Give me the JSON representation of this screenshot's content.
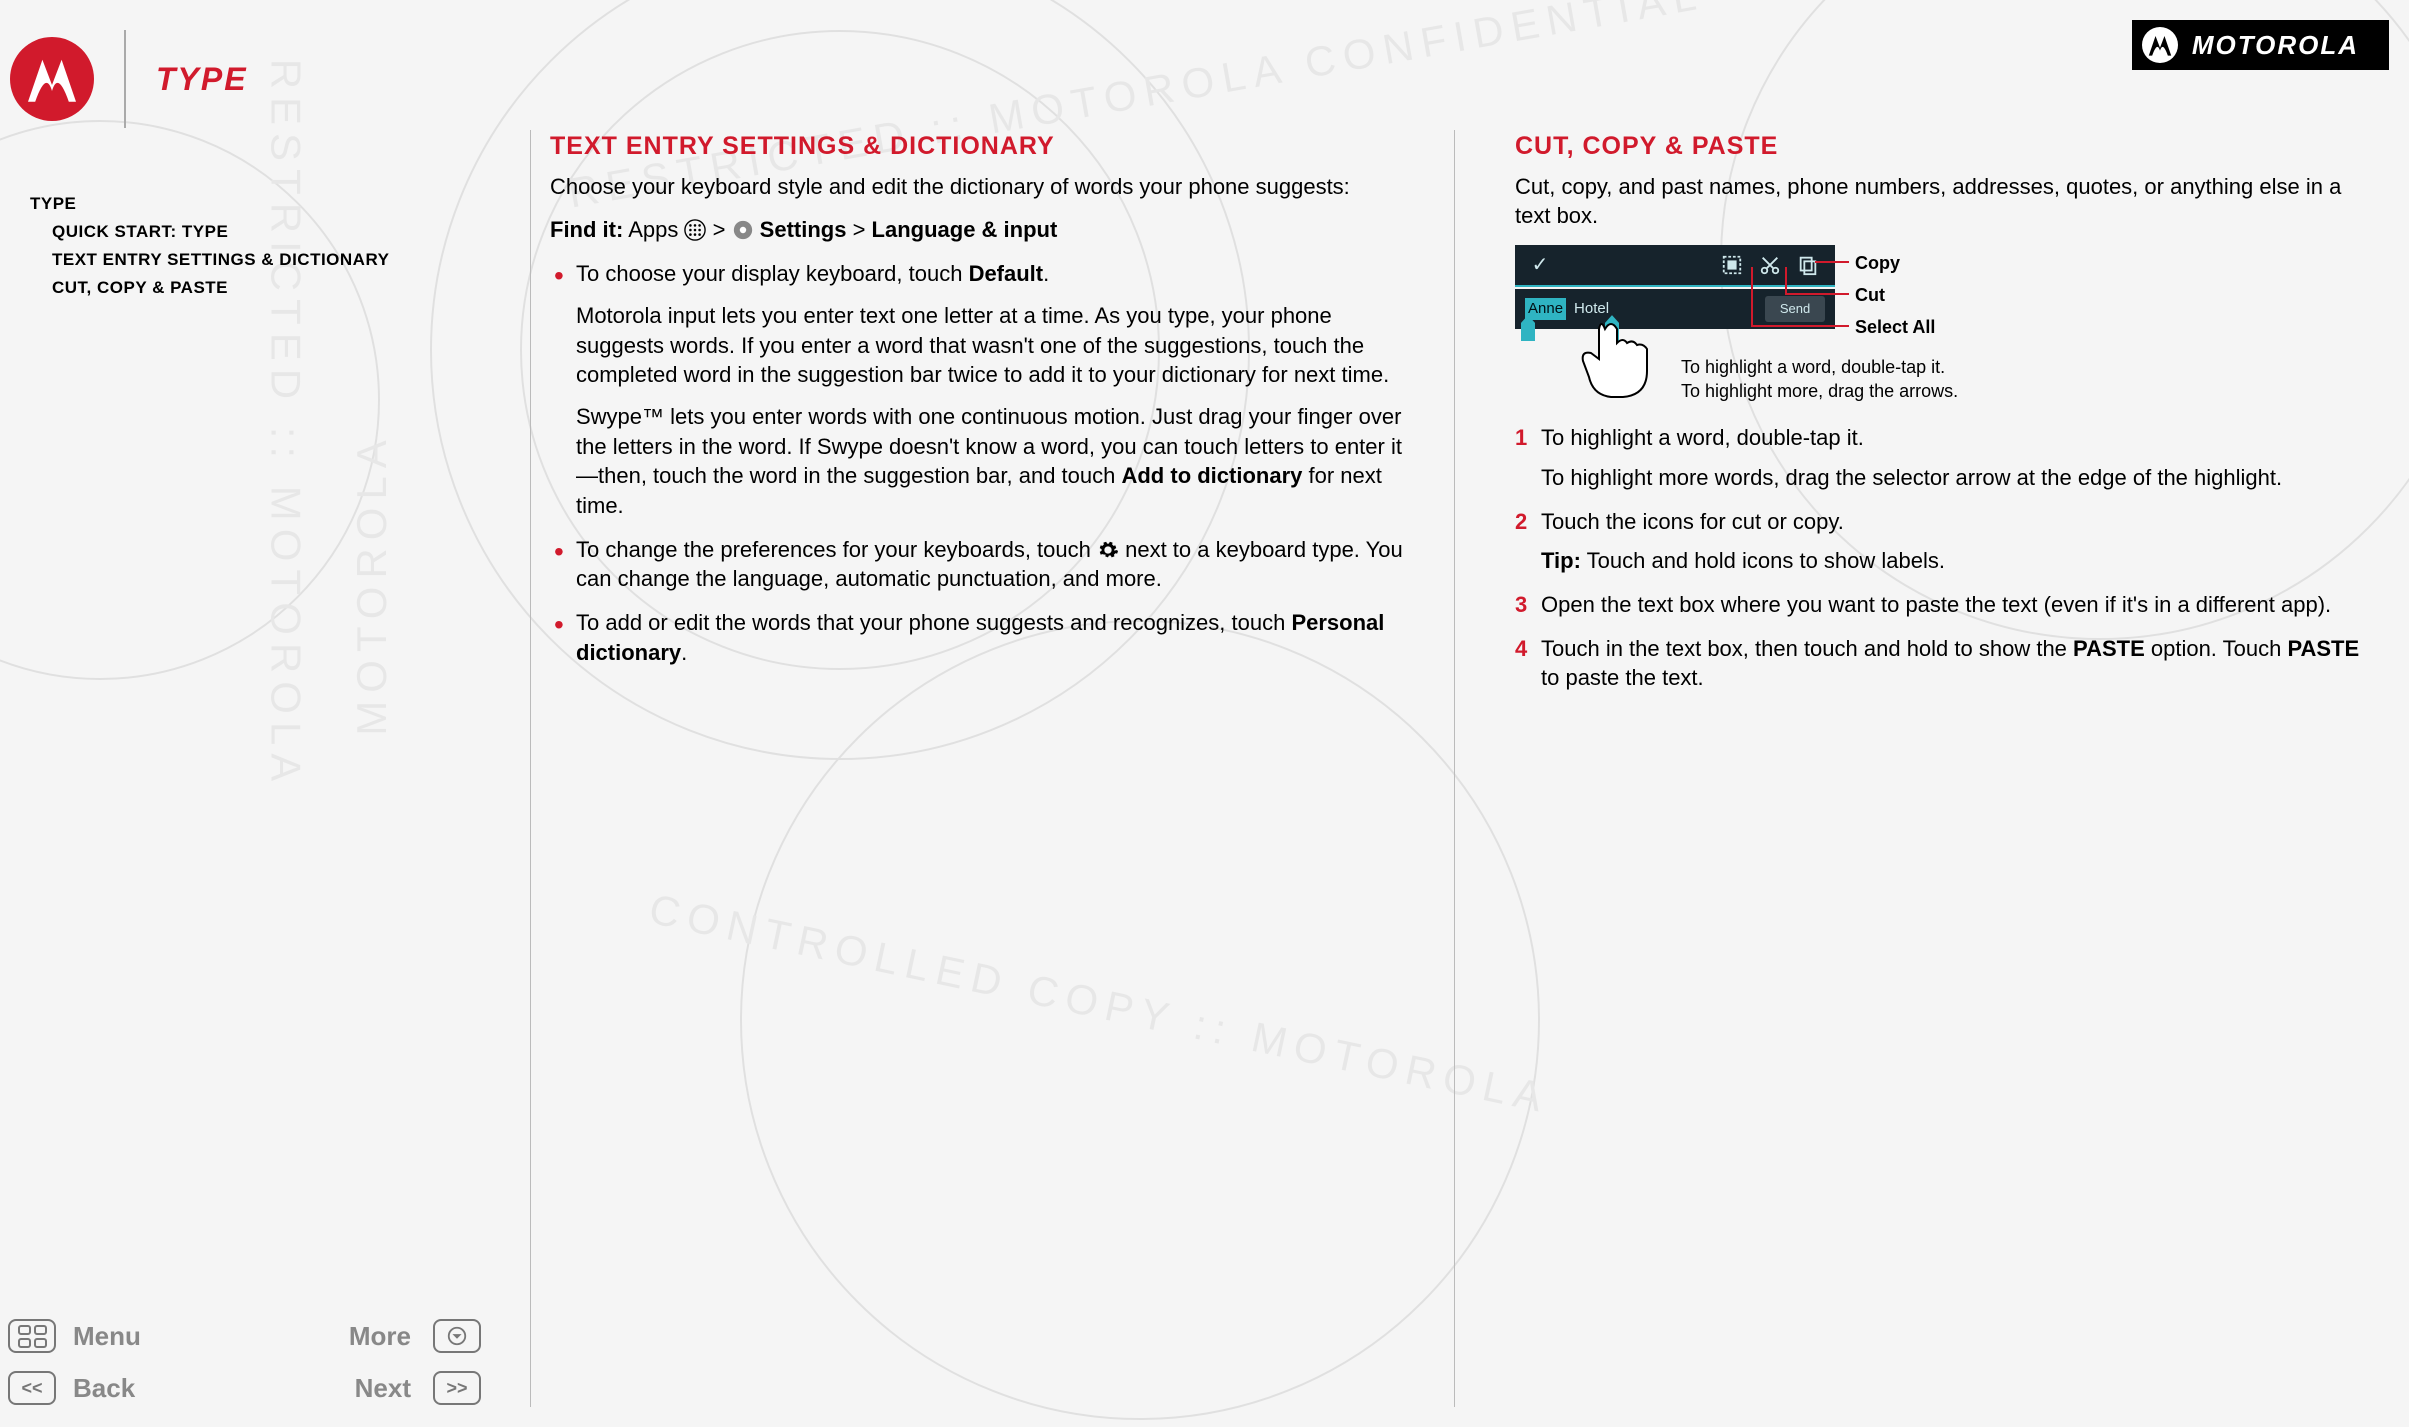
{
  "brand": {
    "name": "MOTOROLA"
  },
  "page_title": "TYPE",
  "toc": {
    "root": "TYPE",
    "items": [
      "QUICK START: TYPE",
      "TEXT ENTRY SETTINGS & DICTIONARY",
      "CUT, COPY & PASTE"
    ]
  },
  "col1": {
    "heading": "TEXT ENTRY SETTINGS & DICTIONARY",
    "intro": "Choose your keyboard style and edit the dictionary of words your phone suggests:",
    "find_it_label": "Find it:",
    "find_it_apps": " Apps ",
    "find_it_sep1": " > ",
    "find_it_settings": " Settings",
    "find_it_sep2": " > ",
    "find_it_lang": "Language & input",
    "b1": "To choose your display keyboard, touch ",
    "b1_bold": "Default",
    "b1_end": ".",
    "b1_p2": "Motorola input lets you enter text one letter at a time. As you type, your phone suggests words. If you enter a word that wasn't one of the suggestions, touch the completed word in the suggestion bar twice to add it to your dictionary for next time.",
    "b1_p3a": "Swype™ lets you enter words with one continuous motion. Just drag your finger over the letters in the word. If Swype doesn't know a word, you can touch letters to enter it—then, touch the word in the suggestion bar, and touch ",
    "b1_p3_bold": "Add to dictionary",
    "b1_p3b": " for next time.",
    "b2a": "To change the preferences for your keyboards, touch ",
    "b2b": " next to a keyboard type. You can change the language, automatic punctuation, and more.",
    "b3a": "To add or edit the words that your phone suggests and recognizes, touch ",
    "b3_bold": "Personal dictionary",
    "b3b": "."
  },
  "col2": {
    "heading": "CUT, COPY & PASTE",
    "intro": "Cut, copy, and past names, phone numbers, addresses, quotes, or anything else in a text box.",
    "diagram": {
      "selected": "Anne",
      "unselected": "Hotel",
      "send": "Send",
      "callout_copy": "Copy",
      "callout_cut": "Cut",
      "callout_select": "Select All",
      "caption_l1": "To highlight a word, double-tap it.",
      "caption_l2": "To highlight more, drag the arrows."
    },
    "s1": "To highlight a word, double-tap it.",
    "s1_p2": "To highlight more words, drag the selector arrow at the edge of the highlight.",
    "s2": "Touch the icons for cut or copy.",
    "s2_tip_label": "Tip:",
    "s2_tip": " Touch and hold icons to show labels.",
    "s3": "Open the text box where you want to paste the text (even if it's in a different app).",
    "s4a": "Touch in the text box, then touch and hold to show the ",
    "s4_paste1": "PASTE",
    "s4b": " option. Touch ",
    "s4_paste2": "PASTE",
    "s4c": " to paste the text.",
    "n1": "1",
    "n2": "2",
    "n3": "3",
    "n4": "4"
  },
  "nav": {
    "menu": "Menu",
    "more": "More",
    "back": "Back",
    "next": "Next"
  }
}
